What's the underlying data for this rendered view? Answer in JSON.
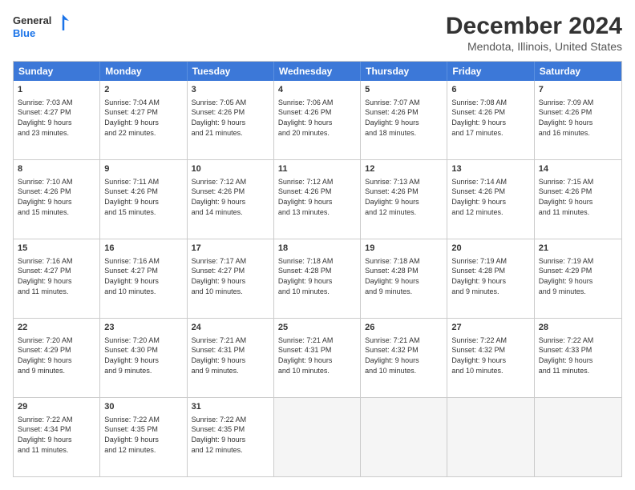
{
  "header": {
    "logo_line1": "General",
    "logo_line2": "Blue",
    "title": "December 2024",
    "subtitle": "Mendota, Illinois, United States"
  },
  "calendar": {
    "weekdays": [
      "Sunday",
      "Monday",
      "Tuesday",
      "Wednesday",
      "Thursday",
      "Friday",
      "Saturday"
    ],
    "rows": [
      [
        {
          "day": "1",
          "info": "Sunrise: 7:03 AM\nSunset: 4:27 PM\nDaylight: 9 hours\nand 23 minutes."
        },
        {
          "day": "2",
          "info": "Sunrise: 7:04 AM\nSunset: 4:27 PM\nDaylight: 9 hours\nand 22 minutes."
        },
        {
          "day": "3",
          "info": "Sunrise: 7:05 AM\nSunset: 4:26 PM\nDaylight: 9 hours\nand 21 minutes."
        },
        {
          "day": "4",
          "info": "Sunrise: 7:06 AM\nSunset: 4:26 PM\nDaylight: 9 hours\nand 20 minutes."
        },
        {
          "day": "5",
          "info": "Sunrise: 7:07 AM\nSunset: 4:26 PM\nDaylight: 9 hours\nand 18 minutes."
        },
        {
          "day": "6",
          "info": "Sunrise: 7:08 AM\nSunset: 4:26 PM\nDaylight: 9 hours\nand 17 minutes."
        },
        {
          "day": "7",
          "info": "Sunrise: 7:09 AM\nSunset: 4:26 PM\nDaylight: 9 hours\nand 16 minutes."
        }
      ],
      [
        {
          "day": "8",
          "info": "Sunrise: 7:10 AM\nSunset: 4:26 PM\nDaylight: 9 hours\nand 15 minutes."
        },
        {
          "day": "9",
          "info": "Sunrise: 7:11 AM\nSunset: 4:26 PM\nDaylight: 9 hours\nand 15 minutes."
        },
        {
          "day": "10",
          "info": "Sunrise: 7:12 AM\nSunset: 4:26 PM\nDaylight: 9 hours\nand 14 minutes."
        },
        {
          "day": "11",
          "info": "Sunrise: 7:12 AM\nSunset: 4:26 PM\nDaylight: 9 hours\nand 13 minutes."
        },
        {
          "day": "12",
          "info": "Sunrise: 7:13 AM\nSunset: 4:26 PM\nDaylight: 9 hours\nand 12 minutes."
        },
        {
          "day": "13",
          "info": "Sunrise: 7:14 AM\nSunset: 4:26 PM\nDaylight: 9 hours\nand 12 minutes."
        },
        {
          "day": "14",
          "info": "Sunrise: 7:15 AM\nSunset: 4:26 PM\nDaylight: 9 hours\nand 11 minutes."
        }
      ],
      [
        {
          "day": "15",
          "info": "Sunrise: 7:16 AM\nSunset: 4:27 PM\nDaylight: 9 hours\nand 11 minutes."
        },
        {
          "day": "16",
          "info": "Sunrise: 7:16 AM\nSunset: 4:27 PM\nDaylight: 9 hours\nand 10 minutes."
        },
        {
          "day": "17",
          "info": "Sunrise: 7:17 AM\nSunset: 4:27 PM\nDaylight: 9 hours\nand 10 minutes."
        },
        {
          "day": "18",
          "info": "Sunrise: 7:18 AM\nSunset: 4:28 PM\nDaylight: 9 hours\nand 10 minutes."
        },
        {
          "day": "19",
          "info": "Sunrise: 7:18 AM\nSunset: 4:28 PM\nDaylight: 9 hours\nand 9 minutes."
        },
        {
          "day": "20",
          "info": "Sunrise: 7:19 AM\nSunset: 4:28 PM\nDaylight: 9 hours\nand 9 minutes."
        },
        {
          "day": "21",
          "info": "Sunrise: 7:19 AM\nSunset: 4:29 PM\nDaylight: 9 hours\nand 9 minutes."
        }
      ],
      [
        {
          "day": "22",
          "info": "Sunrise: 7:20 AM\nSunset: 4:29 PM\nDaylight: 9 hours\nand 9 minutes."
        },
        {
          "day": "23",
          "info": "Sunrise: 7:20 AM\nSunset: 4:30 PM\nDaylight: 9 hours\nand 9 minutes."
        },
        {
          "day": "24",
          "info": "Sunrise: 7:21 AM\nSunset: 4:31 PM\nDaylight: 9 hours\nand 9 minutes."
        },
        {
          "day": "25",
          "info": "Sunrise: 7:21 AM\nSunset: 4:31 PM\nDaylight: 9 hours\nand 10 minutes."
        },
        {
          "day": "26",
          "info": "Sunrise: 7:21 AM\nSunset: 4:32 PM\nDaylight: 9 hours\nand 10 minutes."
        },
        {
          "day": "27",
          "info": "Sunrise: 7:22 AM\nSunset: 4:32 PM\nDaylight: 9 hours\nand 10 minutes."
        },
        {
          "day": "28",
          "info": "Sunrise: 7:22 AM\nSunset: 4:33 PM\nDaylight: 9 hours\nand 11 minutes."
        }
      ],
      [
        {
          "day": "29",
          "info": "Sunrise: 7:22 AM\nSunset: 4:34 PM\nDaylight: 9 hours\nand 11 minutes."
        },
        {
          "day": "30",
          "info": "Sunrise: 7:22 AM\nSunset: 4:35 PM\nDaylight: 9 hours\nand 12 minutes."
        },
        {
          "day": "31",
          "info": "Sunrise: 7:22 AM\nSunset: 4:35 PM\nDaylight: 9 hours\nand 12 minutes."
        },
        {
          "day": "",
          "info": ""
        },
        {
          "day": "",
          "info": ""
        },
        {
          "day": "",
          "info": ""
        },
        {
          "day": "",
          "info": ""
        }
      ]
    ]
  }
}
